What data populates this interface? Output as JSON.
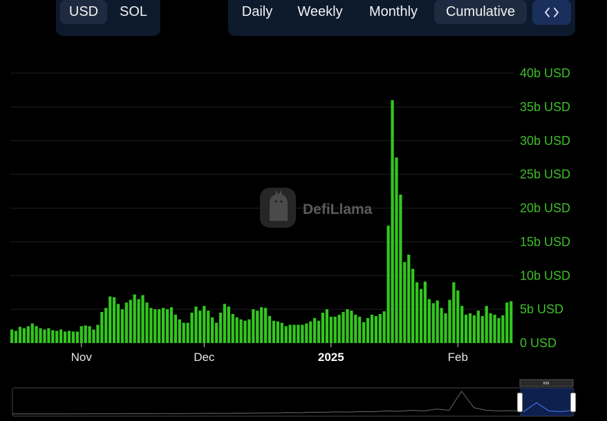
{
  "currency_toggle": {
    "usd": "USD",
    "sol": "SOL",
    "active": "USD"
  },
  "period_toggle": {
    "daily": "Daily",
    "weekly": "Weekly",
    "monthly": "Monthly",
    "cumulative": "Cumulative",
    "active": "Cumulative"
  },
  "embed_icon": "code-brackets-icon",
  "watermark": "DefiLlama",
  "colors": {
    "bar": "#33c61f",
    "ytick": "#3fbf2a",
    "grid": "#1f1f1f",
    "background": "#000000",
    "brush": "#1a3a8c"
  },
  "chart_data": {
    "type": "bar",
    "xlabel": "",
    "ylabel": "",
    "ylim": [
      0,
      40
    ],
    "yticks": [
      "0 USD",
      "5b USD",
      "10b USD",
      "15b USD",
      "20b USD",
      "25b USD",
      "30b USD",
      "35b USD",
      "40b USD"
    ],
    "ytick_values": [
      0,
      5,
      10,
      15,
      20,
      25,
      30,
      35,
      40
    ],
    "xticks": [
      {
        "label": "Nov",
        "index": 17,
        "bold": false
      },
      {
        "label": "Dec",
        "index": 47,
        "bold": false
      },
      {
        "label": "2025",
        "index": 78,
        "bold": true
      },
      {
        "label": "Feb",
        "index": 109,
        "bold": false
      }
    ],
    "grid": true,
    "unit": "b USD",
    "values": [
      2.0,
      1.8,
      2.4,
      2.2,
      2.5,
      2.9,
      2.5,
      2.2,
      2.0,
      2.2,
      1.9,
      1.8,
      2.0,
      1.7,
      1.8,
      1.7,
      1.7,
      2.5,
      2.6,
      2.5,
      2.0,
      2.7,
      4.6,
      5.2,
      6.9,
      6.8,
      5.8,
      5.0,
      6.0,
      6.4,
      7.2,
      6.5,
      7.1,
      6.0,
      5.2,
      5.0,
      5.0,
      5.2,
      5.0,
      5.3,
      4.2,
      3.5,
      3.0,
      3.0,
      4.5,
      5.4,
      4.8,
      5.5,
      4.8,
      3.8,
      3.0,
      4.5,
      5.8,
      5.4,
      4.3,
      3.8,
      3.5,
      3.3,
      3.5,
      5.0,
      4.8,
      5.3,
      5.2,
      4.0,
      3.3,
      3.2,
      3.0,
      2.5,
      2.7,
      2.7,
      2.7,
      2.7,
      2.9,
      3.2,
      3.7,
      3.3,
      4.5,
      5.0,
      3.9,
      3.9,
      4.2,
      4.6,
      5.0,
      4.8,
      4.2,
      3.9,
      3.1,
      3.7,
      4.2,
      4.0,
      4.3,
      4.7,
      17.4,
      36.0,
      27.5,
      22.0,
      12.0,
      13.1,
      11.0,
      9.0,
      8.0,
      9.1,
      6.5,
      5.9,
      6.3,
      5.2,
      4.4,
      6.4,
      9.0,
      7.8,
      5.5,
      4.2,
      4.4,
      4.1,
      4.8,
      4.0,
      5.5,
      4.4,
      4.2,
      3.7,
      4.1,
      6.0,
      6.2
    ],
    "overview_values": [
      0.2,
      0.3,
      0.2,
      0.3,
      0.3,
      0.4,
      0.4,
      0.5,
      0.4,
      0.6,
      0.5,
      0.6,
      0.8,
      0.7,
      0.9,
      1.0,
      1.2,
      1.0,
      1.5,
      1.4,
      2.0,
      1.8,
      2.5,
      2.2,
      3.0,
      2.8,
      3.5,
      3.2,
      4.0,
      3.8,
      5.0,
      4.5,
      6.0,
      5.0,
      8.0,
      6.0,
      36.0,
      10.0,
      6.0,
      5.0,
      5.5,
      4.0,
      18.0,
      5.0,
      4.0,
      6.0
    ]
  }
}
